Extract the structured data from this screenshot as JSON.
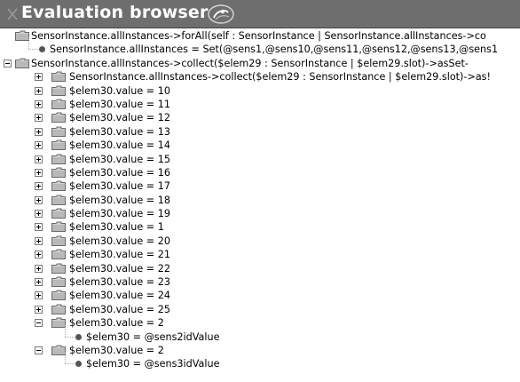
{
  "window": {
    "title": "Evaluation browser"
  },
  "tree": [
    {
      "level": 0,
      "kind": "folder",
      "expander": "none",
      "text": "SensorInstance.allInstances->forAll(self : SensorInstance | SensorInstance.allInstances->co"
    },
    {
      "level": 1,
      "kind": "dot",
      "expander": "none",
      "text": "SensorInstance.allInstances = Set(@sens1,@sens10,@sens11,@sens12,@sens13,@sens1"
    },
    {
      "level": 0,
      "kind": "folder",
      "expander": "minus",
      "text": "SensorInstance.allInstances->collect($elem29 : SensorInstance | $elem29.slot)->asSet-"
    },
    {
      "level": 1,
      "kind": "folder",
      "expander": "plus",
      "text": "SensorInstance.allInstances->collect($elem29 : SensorInstance | $elem29.slot)->as!"
    },
    {
      "level": 1,
      "kind": "folder",
      "expander": "plus",
      "text": "$elem30.value = 10"
    },
    {
      "level": 1,
      "kind": "folder",
      "expander": "plus",
      "text": "$elem30.value = 11"
    },
    {
      "level": 1,
      "kind": "folder",
      "expander": "plus",
      "text": "$elem30.value = 12"
    },
    {
      "level": 1,
      "kind": "folder",
      "expander": "plus",
      "text": "$elem30.value = 13"
    },
    {
      "level": 1,
      "kind": "folder",
      "expander": "plus",
      "text": "$elem30.value = 14"
    },
    {
      "level": 1,
      "kind": "folder",
      "expander": "plus",
      "text": "$elem30.value = 15"
    },
    {
      "level": 1,
      "kind": "folder",
      "expander": "plus",
      "text": "$elem30.value = 16"
    },
    {
      "level": 1,
      "kind": "folder",
      "expander": "plus",
      "text": "$elem30.value = 17"
    },
    {
      "level": 1,
      "kind": "folder",
      "expander": "plus",
      "text": "$elem30.value = 18"
    },
    {
      "level": 1,
      "kind": "folder",
      "expander": "plus",
      "text": "$elem30.value = 19"
    },
    {
      "level": 1,
      "kind": "folder",
      "expander": "plus",
      "text": "$elem30.value = 1"
    },
    {
      "level": 1,
      "kind": "folder",
      "expander": "plus",
      "text": "$elem30.value = 20"
    },
    {
      "level": 1,
      "kind": "folder",
      "expander": "plus",
      "text": "$elem30.value = 21"
    },
    {
      "level": 1,
      "kind": "folder",
      "expander": "plus",
      "text": "$elem30.value = 22"
    },
    {
      "level": 1,
      "kind": "folder",
      "expander": "plus",
      "text": "$elem30.value = 23"
    },
    {
      "level": 1,
      "kind": "folder",
      "expander": "plus",
      "text": "$elem30.value = 24"
    },
    {
      "level": 1,
      "kind": "folder",
      "expander": "plus",
      "text": "$elem30.value = 25"
    },
    {
      "level": 1,
      "kind": "folder",
      "expander": "minus",
      "text": "$elem30.value = 2"
    },
    {
      "level": 2,
      "kind": "dot",
      "expander": "none",
      "text": "$elem30 = @sens2idValue"
    },
    {
      "level": 1,
      "kind": "folder",
      "expander": "minus",
      "text": "$elem30.value = 2"
    },
    {
      "level": 2,
      "kind": "dot",
      "expander": "none",
      "text": "$elem30 = @sens3idValue"
    }
  ]
}
